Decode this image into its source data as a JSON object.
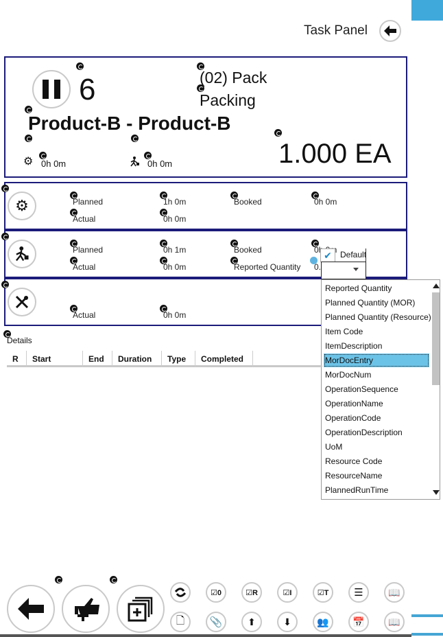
{
  "task_panel": {
    "title": "Task Panel",
    "back_icon": "arrow-left-icon"
  },
  "header_card": {
    "status_icon": "pause-icon",
    "operation_number": "6",
    "operation_code": "(02) Pack",
    "operation_name": "Packing",
    "product": "Product-B - Product-B",
    "setup_time": "0h 0m",
    "run_time": "0h 0m",
    "quantity": "1.000 EA"
  },
  "setup_row": {
    "icon": "gear-icon",
    "planned_label": "Planned",
    "planned_value": "1h 0m",
    "actual_label": "Actual",
    "actual_value": "0h 0m",
    "booked_label": "Booked",
    "booked_value": "0h 0m"
  },
  "run_row": {
    "icon": "worker-icon",
    "planned_label": "Planned",
    "planned_value": "0h 1m",
    "actual_label": "Actual",
    "actual_value": "0h 0m",
    "booked_label": "Booked",
    "booked_value": "0h 0m",
    "reported_label": "Reported Quantity",
    "reported_value": "0.0"
  },
  "tools_row": {
    "icon": "tools-icon",
    "actual_label": "Actual",
    "actual_value": "0h 0m"
  },
  "filter": {
    "default_checked": true,
    "default_label": "Default",
    "selected_value": "",
    "options": [
      "Reported Quantity",
      "Planned Quantity (MOR)",
      "Planned Quantity (Resource)",
      "Item Code",
      "ItemDescription",
      "MorDocEntry",
      "MorDocNum",
      "OperationSequence",
      "OperationName",
      "OperationCode",
      "OperationDescription",
      "UoM",
      "Resource Code",
      "ResourceName",
      "PlannedRunTime"
    ],
    "highlighted": "MorDocEntry"
  },
  "details": {
    "label": "Details",
    "columns": [
      "R",
      "Start",
      "End",
      "Duration",
      "Type",
      "Completed"
    ],
    "rows": []
  },
  "toolbar": {
    "big_buttons": [
      "back-arrow-icon",
      "thumbs-up-add-icon",
      "stacked-add-icon"
    ],
    "small_top": [
      "sync-icon",
      "checklist-o-icon",
      "checklist-r-icon",
      "checklist-i-icon",
      "checklist-t-icon",
      "list-icon",
      "book-download-icon"
    ],
    "small_bottom": [
      "document-icon",
      "paperclip-icon",
      "move-up-icon",
      "move-down-icon",
      "team-icon",
      "calendar-icon",
      "open-book-icon"
    ]
  }
}
